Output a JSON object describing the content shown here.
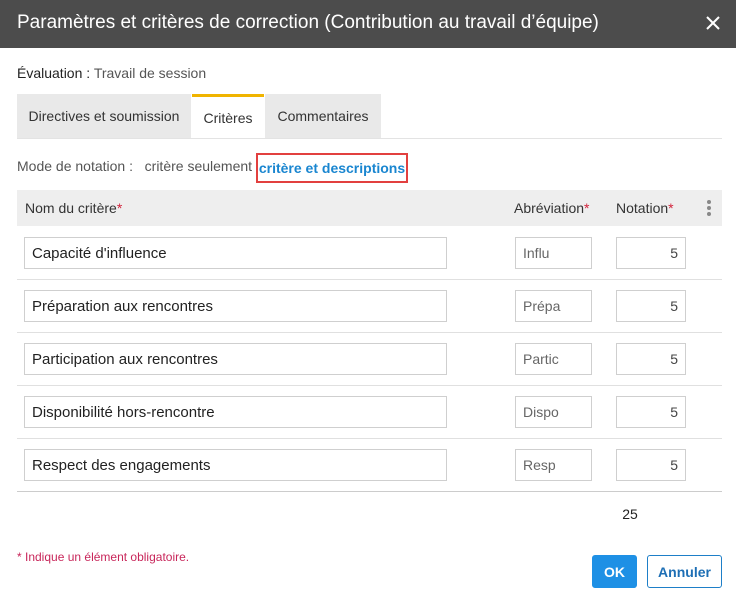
{
  "dialog": {
    "title": "Paramètres et critères de correction (Contribution au travail d’équipe)",
    "close_icon": "close-icon"
  },
  "evaluation": {
    "label": "Évaluation :",
    "value": "Travail de session"
  },
  "tabs": [
    {
      "label": "Directives et soumission",
      "active": false
    },
    {
      "label": "Critères",
      "active": true
    },
    {
      "label": "Commentaires",
      "active": false
    }
  ],
  "grading_mode": {
    "label": "Mode de notation :",
    "option_plain": "critère seulement",
    "option_link": "critère et descriptions"
  },
  "table": {
    "headers": {
      "name": "Nom du critère",
      "abbr": "Abréviation",
      "score": "Notation",
      "required_mark": "*"
    },
    "rows": [
      {
        "name": "Capacité d'influence",
        "abbr": "Influ",
        "score": "5"
      },
      {
        "name": "Préparation aux rencontres",
        "abbr": "Prépa",
        "score": "5"
      },
      {
        "name": "Participation aux rencontres",
        "abbr": "Partic",
        "score": "5"
      },
      {
        "name": "Disponibilité hors-rencontre",
        "abbr": "Dispo",
        "score": "5"
      },
      {
        "name": "Respect des engagements",
        "abbr": "Resp",
        "score": "5"
      }
    ],
    "total": "25"
  },
  "footer": {
    "required_note": "* Indique un élément obligatoire.",
    "ok_label": "OK",
    "cancel_label": "Annuler"
  },
  "colors": {
    "titlebar": "#4c4c4c",
    "active_tab_accent": "#f0b400",
    "link": "#1a86d0",
    "highlight_border": "#e2403f",
    "required": "#d2233c",
    "primary_button": "#1e90e5"
  }
}
